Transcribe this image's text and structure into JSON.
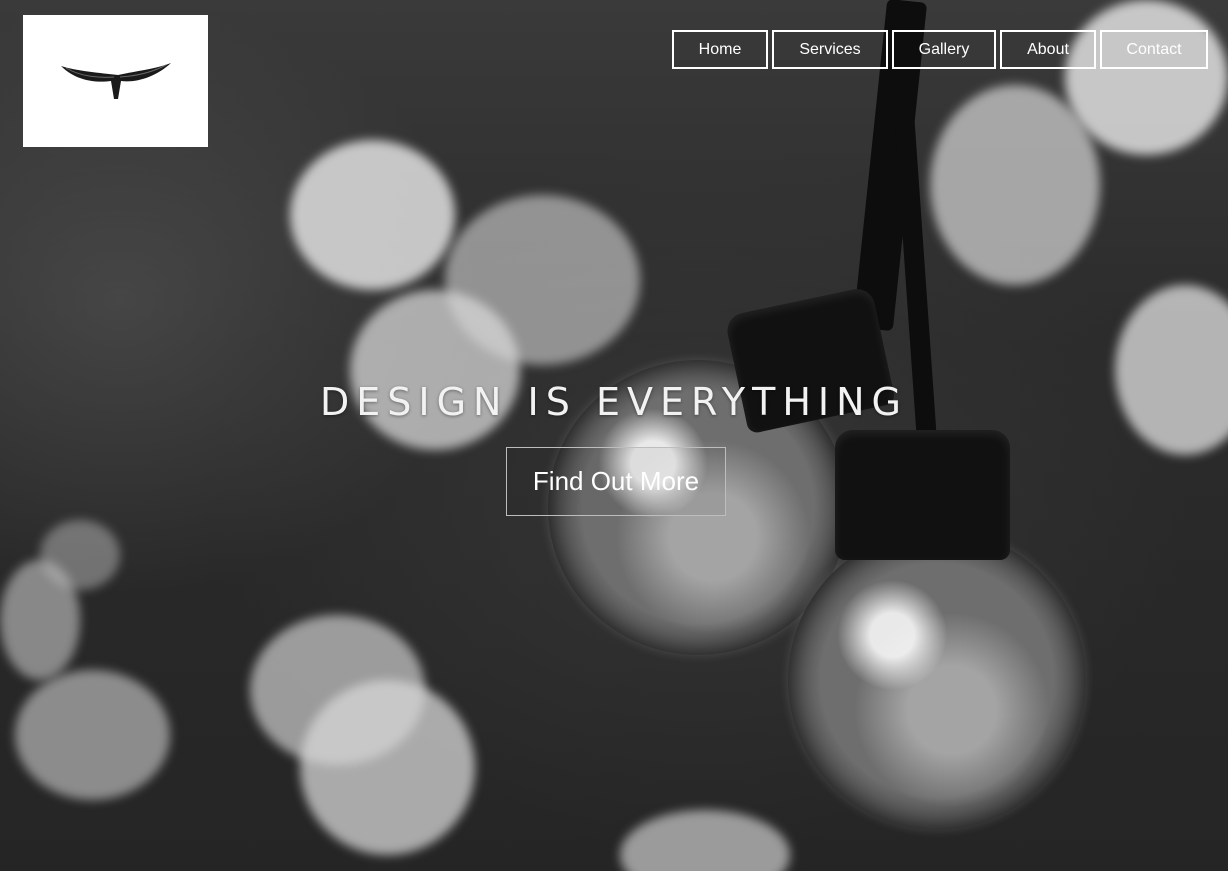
{
  "logo": {
    "icon": "whale-tail-icon"
  },
  "nav": {
    "items": [
      {
        "label": "Home"
      },
      {
        "label": "Services"
      },
      {
        "label": "Gallery"
      },
      {
        "label": "About"
      },
      {
        "label": "Contact"
      }
    ]
  },
  "hero": {
    "headline": "DESIGN IS EVERYTHING",
    "cta_label": "Find Out More"
  },
  "colors": {
    "nav_border": "#ffffff",
    "nav_text": "#ffffff",
    "logo_bg": "#ffffff",
    "cta_border": "#bdbdbd"
  }
}
